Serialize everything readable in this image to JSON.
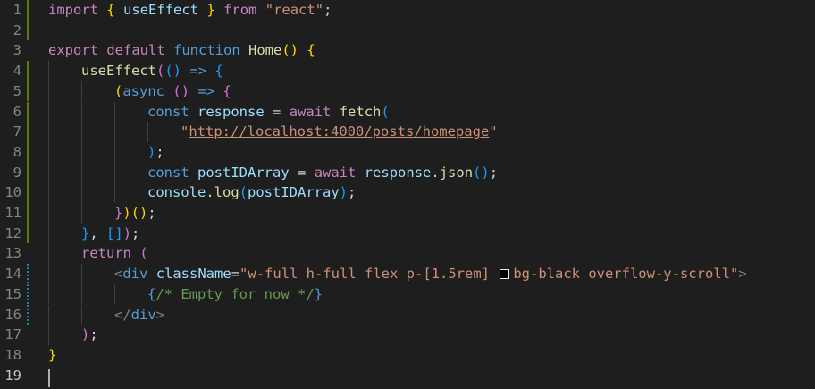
{
  "editor": {
    "line_numbers": [
      "1",
      "2",
      "3",
      "4",
      "5",
      "6",
      "7",
      "8",
      "9",
      "10",
      "11",
      "12",
      "13",
      "14",
      "15",
      "16",
      "17",
      "18",
      "19"
    ],
    "colors": {
      "background": "#1e1e1e",
      "keyword": "#c586c0",
      "storage": "#569cd6",
      "function": "#dcdcaa",
      "variable": "#9cdcfe",
      "string": "#ce9178",
      "comment": "#6a9955",
      "bracket_1": "#ffd700",
      "bracket_2": "#da70d6",
      "bracket_3": "#179fff",
      "gutter_added": "#587c0c",
      "gutter_modified": "#1b81a8"
    },
    "code": {
      "l1": {
        "import": "import",
        "ob": "{",
        "name": "useEffect",
        "cb": "}",
        "from": "from",
        "module": "\"react\"",
        "semi": ";"
      },
      "l3": {
        "export": "export",
        "default": "default",
        "function": "function",
        "name": "Home",
        "parens": "()",
        "ob": "{"
      },
      "l4": {
        "call": "useEffect",
        "open": "(",
        "arrow_args": "()",
        "arrow": "=>",
        "ob": "{"
      },
      "l5": {
        "open": "(",
        "async": "async",
        "args": "()",
        "arrow": "=>",
        "ob": "{"
      },
      "l6": {
        "const": "const",
        "name": "response",
        "eq": "=",
        "await": "await",
        "fetch": "fetch",
        "open": "("
      },
      "l7": {
        "url_open_quote": "\"",
        "url": "http://localhost:4000/posts/homepage",
        "url_close_quote": "\""
      },
      "l8": {
        "close": ")",
        "semi": ";"
      },
      "l9": {
        "const": "const",
        "name": "postIDArray",
        "eq": "=",
        "await": "await",
        "obj": "response",
        "dot": ".",
        "method": "json",
        "parens": "()",
        "semi": ";"
      },
      "l10": {
        "obj": "console",
        "dot": ".",
        "method": "log",
        "open": "(",
        "arg": "postIDArray",
        "close": ")",
        "semi": ";"
      },
      "l11": {
        "cb": "}",
        "close": ")",
        "parens": "()",
        "semi": ";"
      },
      "l12": {
        "cb": "}",
        "comma": ",",
        "arr": "[]",
        "close": ")",
        "semi": ";"
      },
      "l13": {
        "return": "return",
        "open": "("
      },
      "l14": {
        "lt": "<",
        "tag": "div",
        "attr": "className",
        "eq": "=",
        "value_start": "\"w-full h-full flex p-[1.5rem] ",
        "value_end": "bg-black overflow-y-scroll\"",
        "gt": ">"
      },
      "l15": {
        "ob": "{",
        "comment": "/* Empty for now */",
        "cb": "}"
      },
      "l16": {
        "lt": "</",
        "tag": "div",
        "gt": ">"
      },
      "l17": {
        "close": ")",
        "semi": ";"
      },
      "l18": {
        "cb": "}"
      }
    },
    "swatch_color": "#000000"
  }
}
